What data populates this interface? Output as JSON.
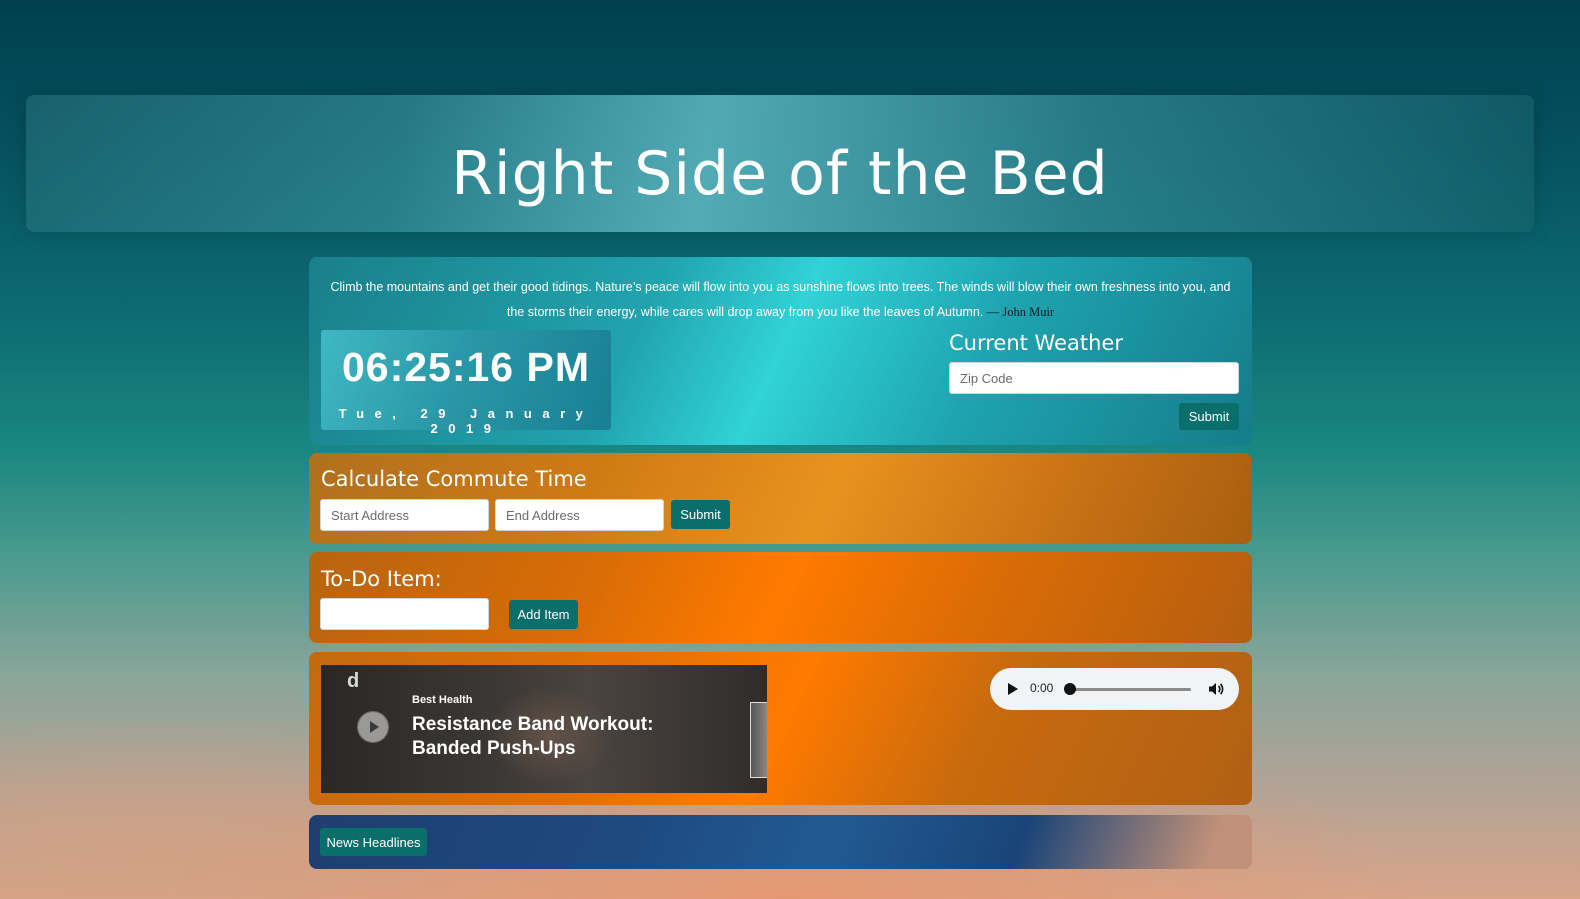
{
  "header": {
    "title": "Right Side of the Bed"
  },
  "quote": {
    "text": "Climb the mountains and get their good tidings. Nature’s peace will flow into you as sunshine flows into trees. The winds will blow their own freshness into you, and the storms their energy, while cares will drop away from you like the leaves of Autumn.",
    "author": "— John Muir"
  },
  "clock": {
    "time": "06:25:16 PM",
    "date": "Tue, 29 January 2019"
  },
  "weather": {
    "title": "Current Weather",
    "zip_placeholder": "Zip Code",
    "submit_label": "Submit"
  },
  "commute": {
    "title": "Calculate Commute Time",
    "start_placeholder": "Start Address",
    "end_placeholder": "End Address",
    "submit_label": "Submit"
  },
  "todo": {
    "title": "To-Do Item:",
    "input_value": "",
    "add_label": "Add Item"
  },
  "video": {
    "logo": "d",
    "brand": "Best Health",
    "title": "Resistance Band Workout: Banded Push-Ups",
    "icons": [
      "play-icon"
    ]
  },
  "audio": {
    "time": "0:00",
    "progress": 0,
    "icons": [
      "play-icon",
      "volume-icon"
    ]
  },
  "news": {
    "button_label": "News Headlines"
  },
  "colors": {
    "button": "#0a6e6a",
    "quote_panel": "#21a3ae",
    "orange_panel": "#ff7a00",
    "news_panel": "#1e4a80"
  }
}
